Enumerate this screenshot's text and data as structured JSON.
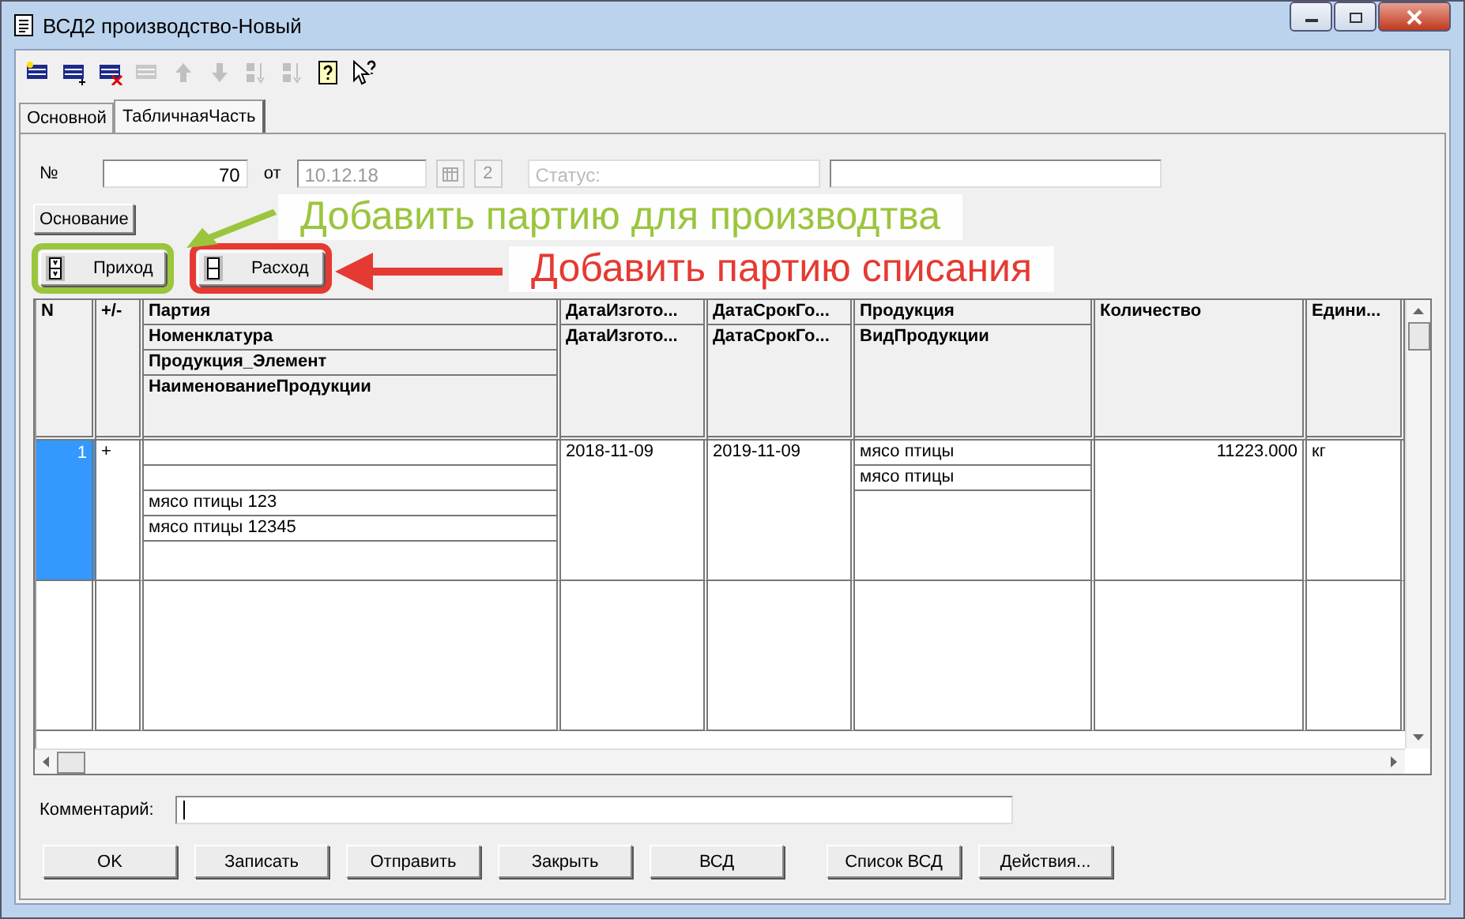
{
  "window": {
    "title": "ВСД2 производство-Новый"
  },
  "toolbar": [
    {
      "kind": "new",
      "disabled": false
    },
    {
      "kind": "add",
      "disabled": false
    },
    {
      "kind": "delete",
      "disabled": false
    },
    {
      "kind": "copy",
      "disabled": true
    },
    {
      "kind": "up",
      "disabled": true
    },
    {
      "kind": "down",
      "disabled": true
    },
    {
      "kind": "sort-asc",
      "disabled": true
    },
    {
      "kind": "sort-desc",
      "disabled": true
    },
    {
      "kind": "help",
      "disabled": false
    },
    {
      "kind": "whats-this",
      "disabled": false
    }
  ],
  "tabs": [
    {
      "label": "Основной",
      "selected": false
    },
    {
      "label": "ТабличнаяЧасть",
      "selected": true
    }
  ],
  "form": {
    "number_label": "№",
    "number": "70",
    "date_label": "от",
    "date": "10.12.18",
    "count": "2",
    "status_placeholder": "Статус:",
    "basis_button": "Основание"
  },
  "actions": [
    {
      "label": "Приход",
      "kind": "in"
    },
    {
      "label": "Расход",
      "kind": "out"
    }
  ],
  "callouts": [
    {
      "text": "Добавить партию для производтва",
      "color": "#9bc53d"
    },
    {
      "text": "Добавить партию списания",
      "color": "#e53a32"
    }
  ],
  "table": {
    "columns": [
      {
        "lines": [
          "N"
        ]
      },
      {
        "lines": [
          "+/-"
        ]
      },
      {
        "lines": [
          "Партия",
          "Номенклатура",
          "Продукция_Элемент",
          "НаименованиеПродукции"
        ]
      },
      {
        "lines": [
          "ДатаИзгото...",
          "ДатаИзгото..."
        ]
      },
      {
        "lines": [
          "ДатаСрокГо...",
          "ДатаСрокГо..."
        ]
      },
      {
        "lines": [
          "Продукция",
          "ВидПродукции"
        ]
      },
      {
        "lines": [
          "Количество"
        ]
      },
      {
        "lines": [
          "Едини..."
        ]
      }
    ],
    "rows": [
      {
        "selected": true,
        "cells": [
          [
            "1"
          ],
          [
            "+"
          ],
          [
            "",
            "",
            "мясо птицы 123",
            "мясо птицы 12345"
          ],
          [
            "2018-11-09"
          ],
          [
            "2019-11-09"
          ],
          [
            "мясо птицы",
            "мясо птицы"
          ],
          [
            "11223.000"
          ],
          [
            "кг"
          ]
        ]
      }
    ]
  },
  "comment": {
    "label": "Комментарий:"
  },
  "buttons": [
    "OK",
    "Записать",
    "Отправить",
    "Закрыть",
    "ВСД",
    "Список ВСД",
    "Действия..."
  ]
}
